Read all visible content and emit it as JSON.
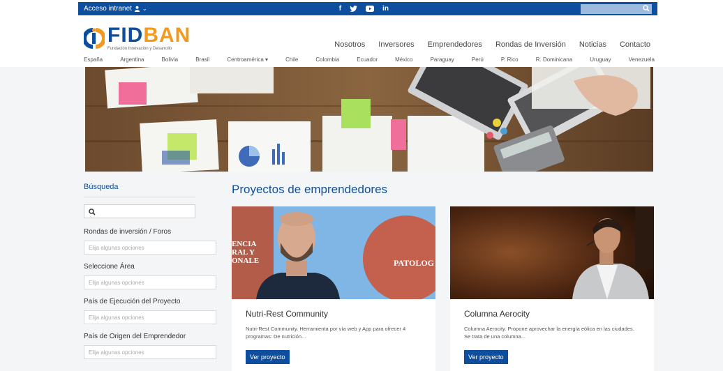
{
  "topbar": {
    "intranet_label": "Acceso intranet",
    "social": [
      "f",
      "y",
      "yt",
      "in"
    ],
    "search_placeholder": ""
  },
  "logo": {
    "brand_fid": "FID",
    "brand_ban": "BAN",
    "tagline": "Fundación Innovación y Desarrollo"
  },
  "main_nav": [
    "Nosotros",
    "Inversores",
    "Emprendedores",
    "Rondas de Inversión",
    "Noticias",
    "Contacto"
  ],
  "country_nav": [
    "España",
    "Argentina",
    "Bolivia",
    "Brasil",
    "Centroamérica ▾",
    "Chile",
    "Colombia",
    "Ecuador",
    "México",
    "Paraguay",
    "Perú",
    "P. Rico",
    "R. Dominicana",
    "Uruguay",
    "Venezuela"
  ],
  "sidebar": {
    "title": "Búsqueda",
    "search_placeholder": "",
    "filters": [
      {
        "label": "Rondas de inversión / Foros",
        "placeholder": "Elija algunas opciones"
      },
      {
        "label": "Seleccione Área",
        "placeholder": "Elija algunas opciones"
      },
      {
        "label": "País de Ejecución del Proyecto",
        "placeholder": "Elija algunas opciones"
      },
      {
        "label": "País de Origen del Emprendedor",
        "placeholder": "Elija algunas opciones"
      }
    ]
  },
  "projects": {
    "title": "Proyectos de emprendedores",
    "items": [
      {
        "name": "Nutri-Rest Community",
        "desc": "Nutri-Rest Community. Herramienta por vía web y App para ofrecer 4 programas: De nutrición...",
        "button": "Ver proyecto",
        "img_text_left": "ENCIA\nRAL Y\nONALE",
        "img_text_right": "PATOLOG"
      },
      {
        "name": "Columna Aerocity",
        "desc": "Columna Aerocity. Propone aprovechar la energía eólica en las ciudades. Se trata de una columna...",
        "button": "Ver proyecto"
      }
    ]
  },
  "colors": {
    "primary": "#0d4f9e",
    "accent": "#f29a1f",
    "page_bg": "#f4f5f7"
  }
}
